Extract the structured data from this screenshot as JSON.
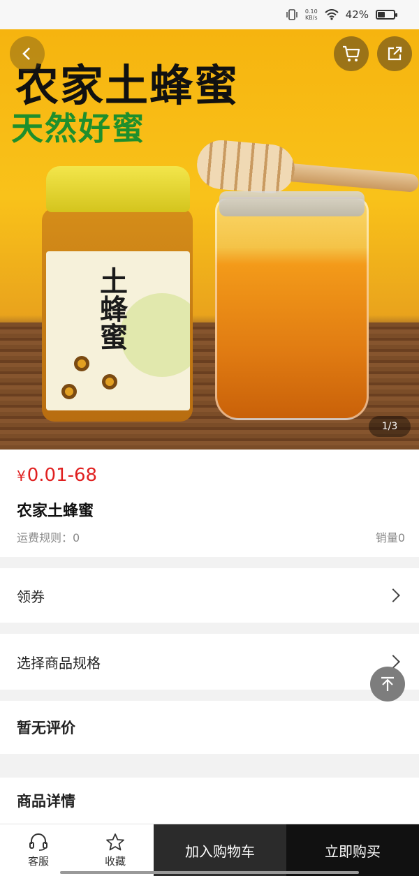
{
  "status_bar": {
    "net_speed_value": "0.10",
    "net_speed_unit": "KB/s",
    "battery_text": "42%",
    "battery_level": 0.42
  },
  "hero": {
    "title": "农家土蜂蜜",
    "subtitle": "天然好蜜",
    "jar_label": "土蜂蜜",
    "counter": "1/3",
    "back_icon": "chevron-left-icon",
    "cart_icon": "cart-icon",
    "share_icon": "share-icon"
  },
  "product": {
    "currency": "¥",
    "price": "0.01-68",
    "name": "农家土蜂蜜",
    "shipping_rule": "运费规则：0",
    "sales": "销量0"
  },
  "rows": {
    "coupon_label": "领券",
    "spec_label": "选择商品规格",
    "reviews_label": "暂无评价",
    "details_label": "商品详情"
  },
  "bottom_bar": {
    "service_label": "客服",
    "favorite_label": "收藏",
    "add_cart_label": "加入购物车",
    "buy_now_label": "立即购买"
  },
  "colors": {
    "price": "#e02020",
    "cart_button": "#2b2b2b",
    "buy_button": "#111111"
  }
}
